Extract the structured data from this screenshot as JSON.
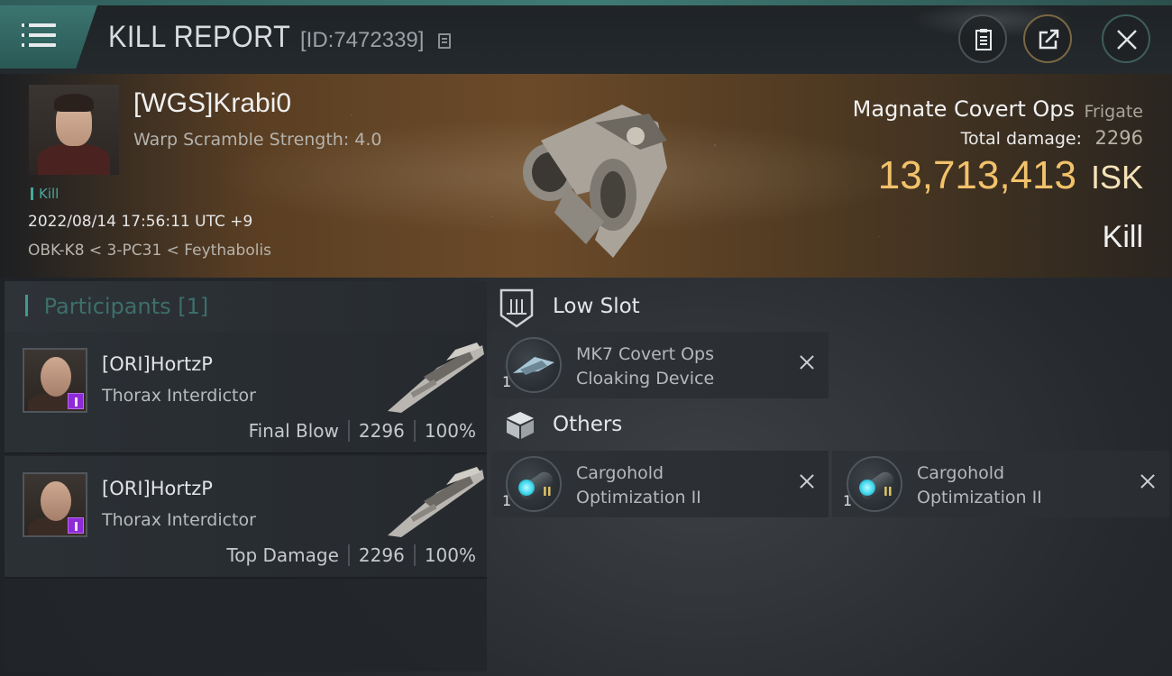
{
  "header": {
    "title": "KILL REPORT",
    "report_id": "[ID:7472339]",
    "icons": [
      "menu-icon",
      "copy-icon",
      "clipboard-icon",
      "share-icon",
      "close-icon"
    ]
  },
  "victim": {
    "name": "[WGS]Krabi0",
    "warp_scramble": "Warp Scramble Strength: 4.0",
    "tag": "Kill",
    "datetime": "2022/08/14 17:56:11 UTC +9",
    "location": "OBK-K8 < 3-PC31 < Feythabolis",
    "ship_name": "Magnate Covert Ops",
    "ship_class": "Frigate",
    "total_damage_label": "Total damage:",
    "total_damage": "2296",
    "isk_value": "13,713,413",
    "isk_unit": "ISK",
    "result": "Kill"
  },
  "participants": {
    "title": "Participants",
    "count": "[1]",
    "rows": [
      {
        "name": "[ORI]HortzP",
        "ship": "Thorax Interdictor",
        "label": "Final Blow",
        "damage": "2296",
        "percent": "100%"
      },
      {
        "name": "[ORI]HortzP",
        "ship": "Thorax Interdictor",
        "label": "Top Damage",
        "damage": "2296",
        "percent": "100%"
      }
    ]
  },
  "fitting": {
    "low_slot": {
      "title": "Low Slot",
      "modules": [
        {
          "name_line1": "MK7 Covert Ops",
          "name_line2": "Cloaking Device",
          "qty": "1"
        }
      ]
    },
    "others": {
      "title": "Others",
      "modules": [
        {
          "name_line1": "Cargohold",
          "name_line2": "Optimization II",
          "qty": "1",
          "tier": "II"
        },
        {
          "name_line1": "Cargohold",
          "name_line2": "Optimization II",
          "qty": "1",
          "tier": "II"
        }
      ]
    }
  },
  "colors": {
    "accent_teal": "#3f9a90",
    "isk_gold": "#f2c26b",
    "badge_purple": "#8e2bd6"
  }
}
